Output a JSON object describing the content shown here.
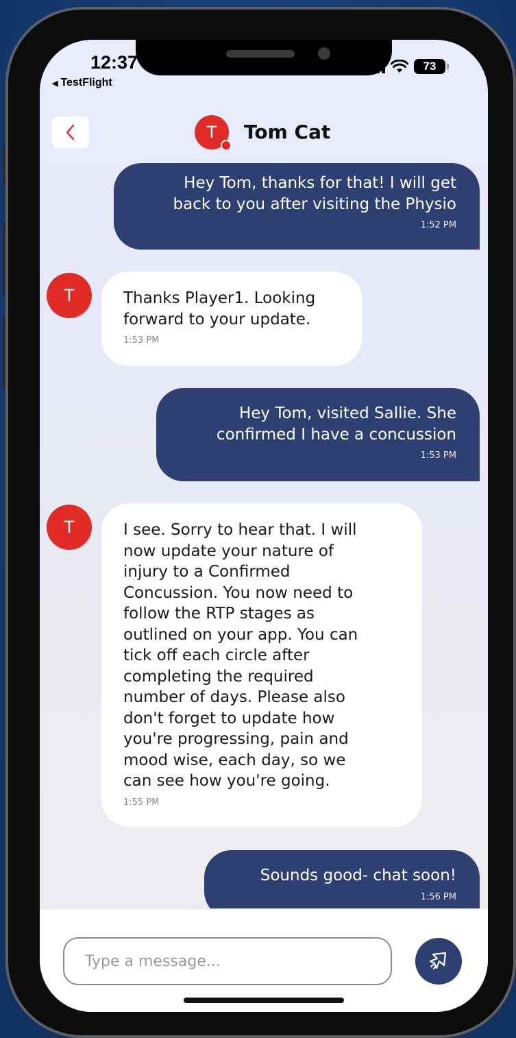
{
  "status_bar": {
    "time": "12:37",
    "back_app": "TestFlight",
    "battery": "73"
  },
  "header": {
    "contact_initial": "T",
    "contact_name": "Tom Cat"
  },
  "messages": [
    {
      "direction": "out",
      "text": "Hey Tom, thanks for that! I will get\nback to you after visiting the Physio",
      "time": "1:52 PM"
    },
    {
      "direction": "in",
      "initial": "T",
      "text": "Thanks Player1. Looking\nforward to your update.",
      "time": "1:53 PM"
    },
    {
      "direction": "out",
      "text": "Hey Tom, visited Sallie. She\nconfirmed I have a concussion",
      "time": "1:53 PM"
    },
    {
      "direction": "in",
      "initial": "T",
      "text": "I see. Sorry to hear that. I will\nnow update your nature of\ninjury to a Confirmed\nConcussion. You now need to\nfollow the RTP stages as\noutlined on your app. You can\ntick off each circle after\ncompleting the required\nnumber of days. Please also\ndon't forget to update how\nyou're progressing, pain and\nmood wise, each day, so we\ncan see how you're going.",
      "time": "1:55 PM"
    },
    {
      "direction": "out",
      "text": "Sounds good- chat soon!",
      "time": "1:56 PM"
    }
  ],
  "composer": {
    "placeholder": "Type a message..."
  },
  "colors": {
    "outgoing_bubble": "#2e3f72",
    "incoming_bubble": "#ffffff",
    "avatar": "#e02b27",
    "online_dot": "#ff1a1a",
    "back_chevron": "#e0333a"
  }
}
